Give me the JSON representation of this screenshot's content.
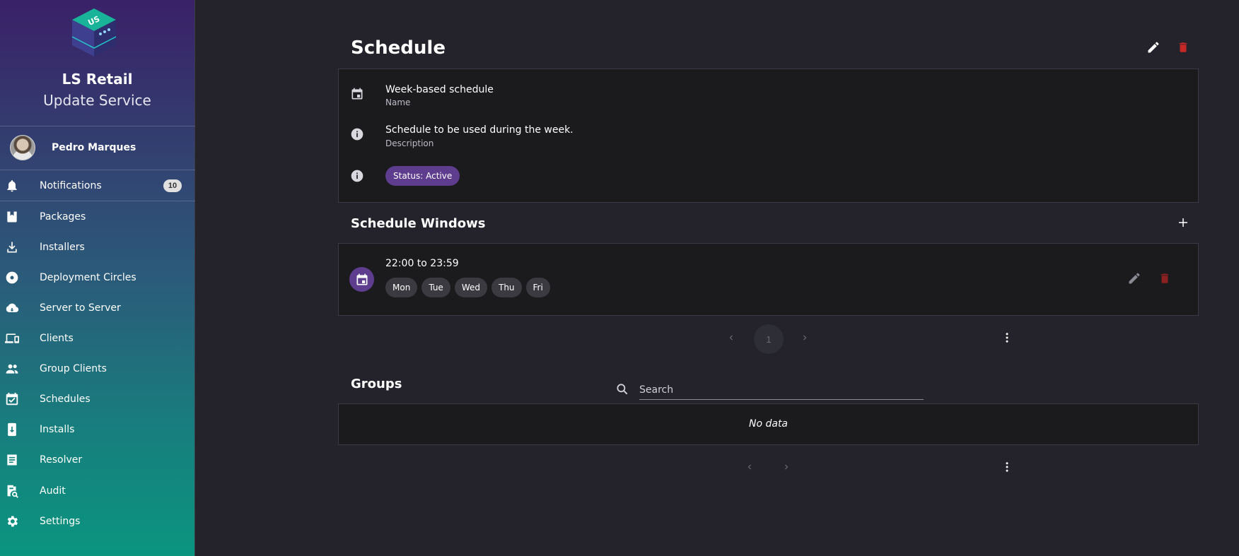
{
  "brand": {
    "name": "LS Retail",
    "subtitle": "Update Service",
    "logo_text": "US"
  },
  "user": {
    "name": "Pedro Marques"
  },
  "nav": [
    {
      "label": "Notifications",
      "icon": "bell-icon",
      "badge": "10"
    },
    {
      "label": "Packages",
      "icon": "package-icon"
    },
    {
      "label": "Installers",
      "icon": "download-icon"
    },
    {
      "label": "Deployment Circles",
      "icon": "disc-icon"
    },
    {
      "label": "Server to Server",
      "icon": "cloud-sync-icon"
    },
    {
      "label": "Clients",
      "icon": "devices-icon"
    },
    {
      "label": "Group Clients",
      "icon": "people-icon"
    },
    {
      "label": "Schedules",
      "icon": "calendar-check-icon"
    },
    {
      "label": "Installs",
      "icon": "install-icon"
    },
    {
      "label": "Resolver",
      "icon": "list-icon"
    },
    {
      "label": "Audit",
      "icon": "audit-search-icon"
    },
    {
      "label": "Settings",
      "icon": "gear-icon"
    }
  ],
  "schedule": {
    "title": "Schedule",
    "name_value": "Week-based schedule",
    "name_caption": "Name",
    "description_value": "Schedule to be used during the week.",
    "description_caption": "Description",
    "status": "Status: Active"
  },
  "windows": {
    "title": "Schedule Windows",
    "items": [
      {
        "time": "22:00 to 23:59",
        "days": [
          "Mon",
          "Tue",
          "Wed",
          "Thu",
          "Fri"
        ]
      }
    ],
    "page": "1"
  },
  "groups": {
    "title": "Groups",
    "search_placeholder": "Search",
    "empty_text": "No data"
  },
  "colors": {
    "accent": "#5e3d8f",
    "danger": "#c62828",
    "background": "#24232c",
    "card": "#1b1b1e"
  }
}
